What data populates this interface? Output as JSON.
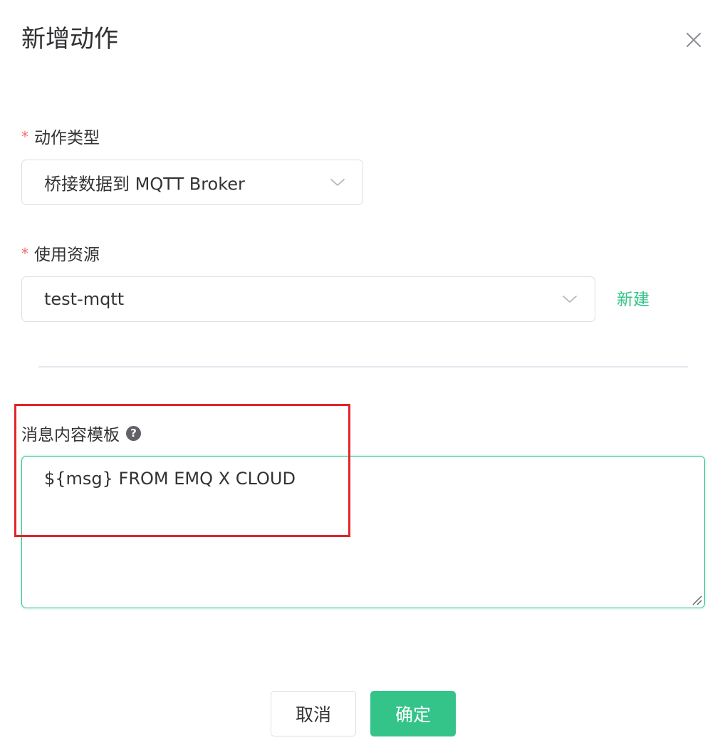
{
  "dialog": {
    "title": "新增动作",
    "close_icon": "close-icon"
  },
  "form": {
    "action_type": {
      "label": "动作类型",
      "required_mark": "*",
      "value": "桥接数据到 MQTT Broker",
      "icon": "chevron-down-icon"
    },
    "resource": {
      "label": "使用资源",
      "required_mark": "*",
      "value": "test-mqtt",
      "icon": "chevron-down-icon",
      "new_link": "新建"
    },
    "payload_template": {
      "label": "消息内容模板",
      "help_icon": "question-circle-icon",
      "help_glyph": "?",
      "value": "${msg} FROM EMQ X CLOUD"
    }
  },
  "footer": {
    "cancel_label": "取消",
    "confirm_label": "确定"
  },
  "colors": {
    "accent": "#34c388",
    "required": "#f56c6c",
    "annotation": "#e1242a",
    "border": "#dcdfe6",
    "text": "#333333"
  }
}
